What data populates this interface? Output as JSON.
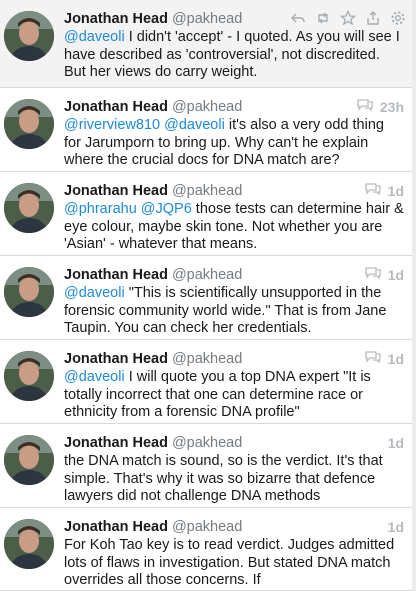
{
  "tweets": [
    {
      "name": "Jonathan Head",
      "handle": "@pakhead",
      "time": "",
      "selected": true,
      "mention": "@daveoli",
      "text": " I didn't 'accept' - I quoted. As you will see I have described as 'controversial', not discredited. But her views do carry weight."
    },
    {
      "name": "Jonathan Head",
      "handle": "@pakhead",
      "time": "23h",
      "mention": "@riverview810 @daveoli",
      "text": " it's also a very odd thing for Jarumporn to bring up. Why can't he explain where the crucial docs for DNA match are?"
    },
    {
      "name": "Jonathan Head",
      "handle": "@pakhead",
      "time": "1d",
      "mention": "@phrarahu @JQP6",
      "text": " those tests can determine hair & eye colour, maybe skin tone. Not whether you are 'Asian' - whatever that means."
    },
    {
      "name": "Jonathan Head",
      "handle": "@pakhead",
      "time": "1d",
      "mention": "@daveoli",
      "text": " \"This is scientifically unsupported in the forensic community world wide.\" That is from Jane Taupin. You can check her credentials."
    },
    {
      "name": "Jonathan Head",
      "handle": "@pakhead",
      "time": "1d",
      "mention": "@daveoli",
      "text": " I will quote you a top DNA expert \"It is totally incorrect that one can determine race or ethnicity from a forensic DNA profile\""
    },
    {
      "name": "Jonathan Head",
      "handle": "@pakhead",
      "time": "1d",
      "mention": "",
      "text": "the DNA match is sound, so is the verdict. It's that simple. That's why it was so bizarre that defence lawyers did not challenge DNA methods"
    },
    {
      "name": "Jonathan Head",
      "handle": "@pakhead",
      "time": "1d",
      "mention": "",
      "text": "For Koh Tao key is to read verdict. Judges admitted lots of flaws in investigation. But stated DNA match overrides all those concerns. If"
    }
  ]
}
